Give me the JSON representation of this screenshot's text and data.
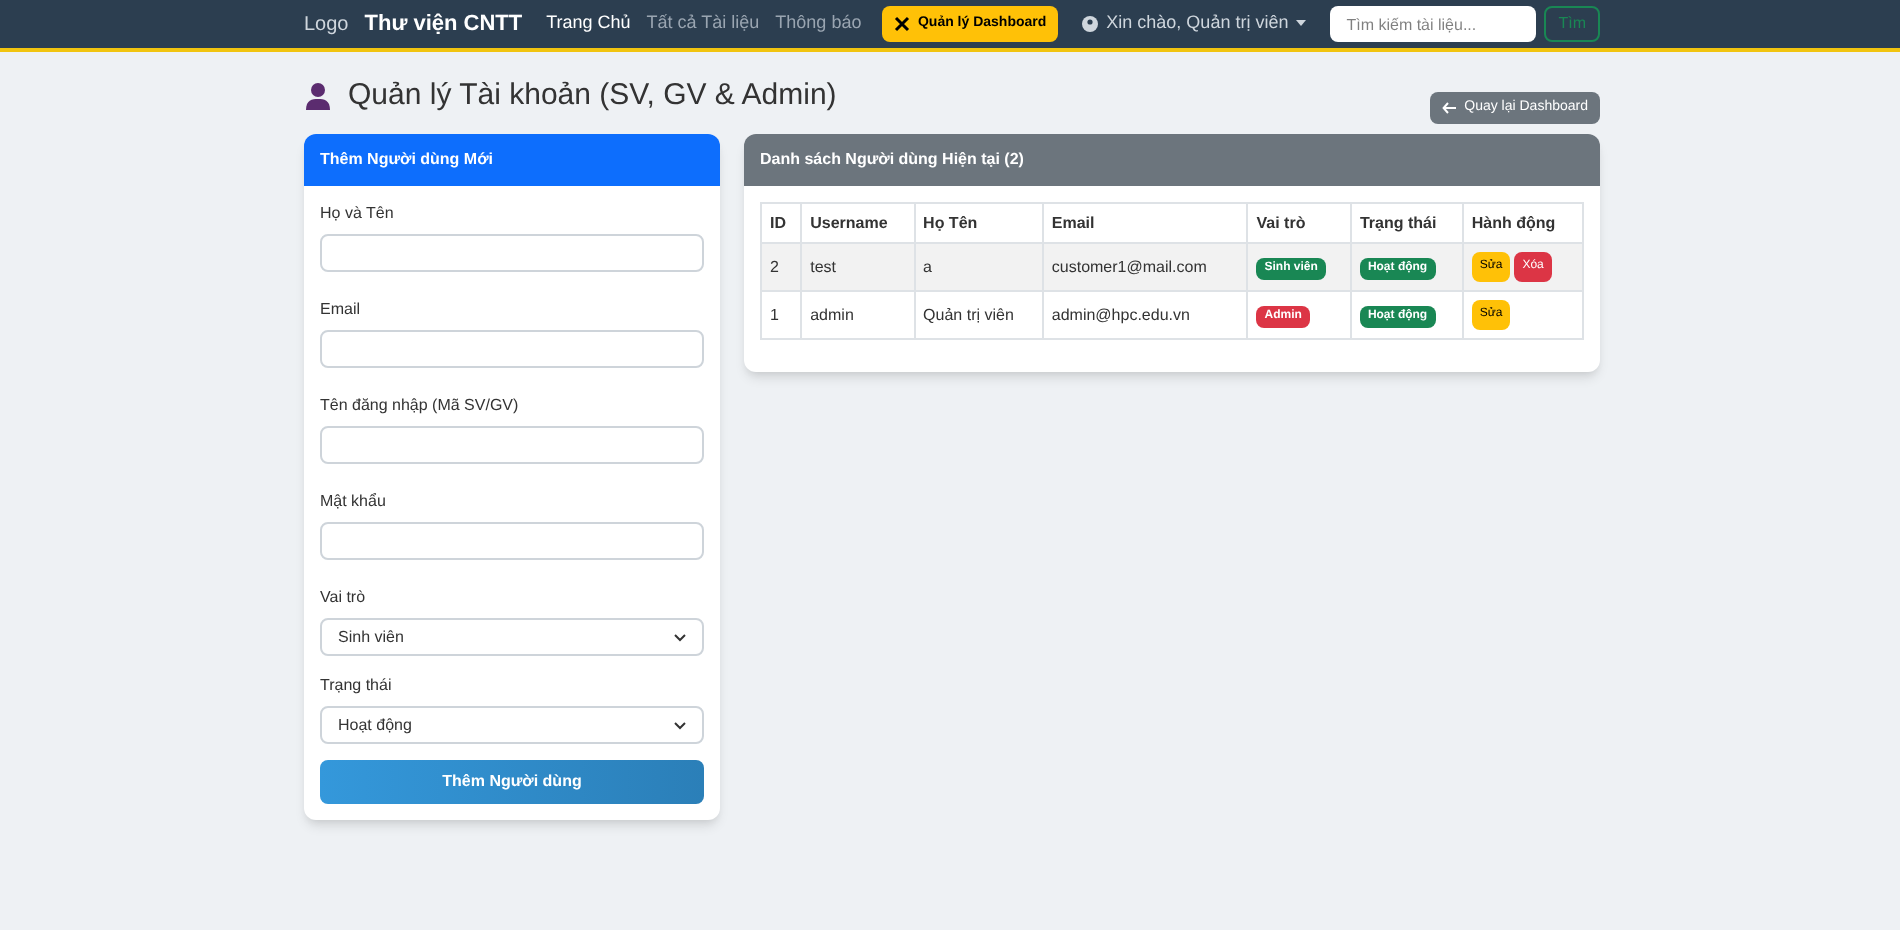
{
  "navbar": {
    "logo_alt": "Logo",
    "brand": "Thư viện CNTT",
    "links": [
      {
        "label": "Trang Chủ",
        "selected": true
      },
      {
        "label": "Tất cả Tài liệu",
        "selected": false
      },
      {
        "label": "Thông báo",
        "selected": false
      }
    ],
    "dashboard_button": "Quản lý Dashboard",
    "user_menu": "Xin chào, Quản trị viên",
    "search": {
      "placeholder": "Tìm kiếm tài liệu...",
      "button": "Tìm"
    }
  },
  "page_title": "Quản lý Tài khoản (SV, GV & Admin)",
  "back_button": "Quay lại Dashboard",
  "form": {
    "title": "Thêm Người dùng Mới",
    "fields": [
      {
        "kind": "text",
        "label": "Họ và Tên"
      },
      {
        "kind": "text",
        "label": "Email"
      },
      {
        "kind": "text",
        "label": "Tên đăng nhập (Mã SV/GV)"
      },
      {
        "kind": "text",
        "label": "Mật khẩu"
      },
      {
        "kind": "select",
        "label": "Vai trò",
        "value": "Sinh viên"
      },
      {
        "kind": "select",
        "label": "Trạng thái",
        "value": "Hoạt động"
      }
    ],
    "submit": "Thêm Người dùng"
  },
  "users": {
    "title": "Danh sách Người dùng Hiện tại (2)",
    "columns": [
      "ID",
      "Username",
      "Họ Tên",
      "Email",
      "Vai trò",
      "Trạng thái",
      "Hành động"
    ],
    "rows": [
      {
        "id": "2",
        "username": "test",
        "name": "a",
        "email": "customer1@mail.com",
        "role": {
          "label": "Sinh viên",
          "color": "#198754"
        },
        "status": {
          "label": "Hoạt động",
          "color": "#198754"
        },
        "actions": [
          "Sửa",
          "Xóa"
        ]
      },
      {
        "id": "1",
        "username": "admin",
        "name": "Quản trị viên",
        "email": "admin@hpc.edu.vn",
        "role": {
          "label": "Admin",
          "color": "#dc3545"
        },
        "status": {
          "label": "Hoạt động",
          "color": "#198754"
        },
        "actions": [
          "Sửa"
        ]
      }
    ]
  }
}
